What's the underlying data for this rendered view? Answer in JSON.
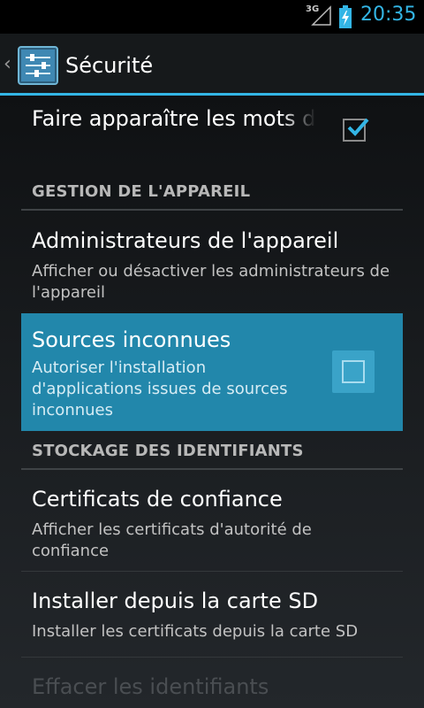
{
  "status_bar": {
    "network_type": "3G",
    "time": "20:35",
    "icons": [
      "signal-icon",
      "battery-charging-icon"
    ]
  },
  "action_bar": {
    "title": "Sécurité",
    "icon": "settings-sliders-icon",
    "up_indicator": "‹"
  },
  "top_item": {
    "title": "Faire apparaître les mots de passe",
    "checked": true
  },
  "sections": [
    {
      "header": "GESTION DE L'APPAREIL",
      "items": [
        {
          "title": "Administrateurs de l'appareil",
          "summary": "Afficher ou désactiver les administrateurs de l'appareil"
        },
        {
          "title": "Sources inconnues",
          "summary": "Autoriser l'installation d'applications issues de sources inconnues",
          "checked": false,
          "pressed": true
        }
      ]
    },
    {
      "header": "STOCKAGE DES IDENTIFIANTS",
      "items": [
        {
          "title": "Certificats de confiance",
          "summary": "Afficher les certificats d'autorité de confiance"
        },
        {
          "title": "Installer depuis la carte SD",
          "summary": "Installer les certificats depuis la carte SD"
        },
        {
          "title": "Effacer les identifiants",
          "enabled": false
        }
      ]
    }
  ],
  "colors": {
    "accent": "#33b5e5",
    "pressed_highlight": "#2287ab",
    "background": "#101214"
  }
}
